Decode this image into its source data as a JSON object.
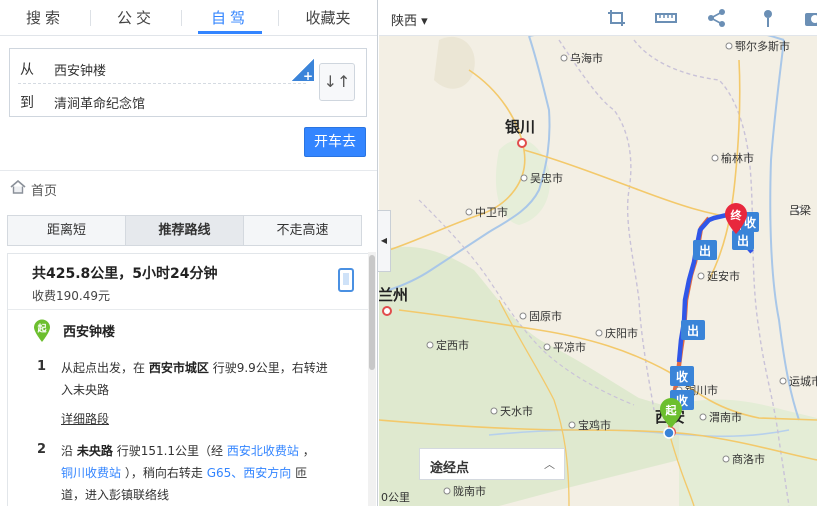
{
  "tabs": [
    {
      "label": "搜索"
    },
    {
      "label": "公交"
    },
    {
      "label": "自驾"
    },
    {
      "label": "收藏夹"
    }
  ],
  "route": {
    "from_label": "从",
    "from_value": "西安钟楼",
    "to_label": "到",
    "to_value": "清涧革命纪念馆",
    "add_symbol": "+",
    "swap_symbol": "↓↑"
  },
  "go_button": "开车去",
  "breadcrumb": "首页",
  "strategies": [
    {
      "label": "距离短"
    },
    {
      "label": "推荐路线"
    },
    {
      "label": "不走高速"
    }
  ],
  "summary": {
    "title": "共425.8公里，5小时24分钟",
    "toll": "收费190.49元"
  },
  "start": {
    "pin": "起",
    "name": "西安钟楼"
  },
  "steps": [
    {
      "no": "1",
      "line1_a": "从起点出发，在",
      "line1_b": "西安市城区",
      "line1_c": "行驶9.9公里，右转进",
      "line2": "入未央路",
      "detail_link": "详细路段"
    },
    {
      "no": "2",
      "line1_a": "沿",
      "line1_b": "未央路",
      "line1_c": "行驶151.1公里（经",
      "line1_link": "西安北收费站",
      "line1_d": "，",
      "line2_link1": "铜川收费站",
      "line2_a": "），稍向右转走",
      "line2_link2": "G65、西安方向",
      "line2_b": "匝",
      "line3": "道，进入彭镇联络线"
    }
  ],
  "collapse_symbol": "◀",
  "map": {
    "region": "陕西",
    "cities": {
      "wuhai": "乌海市",
      "eerduosi": "鄂尔多斯市",
      "yinchuan": "银川",
      "yulin": "榆林市",
      "wuzhong": "吴忠市",
      "zhongwei": "中卫市",
      "lvliang": "吕梁",
      "yanan": "延安市",
      "lanzhou": "兰州",
      "guyuan": "固原市",
      "qingyang": "庆阳市",
      "dingxi": "定西市",
      "pingliang": "平凉市",
      "tongchuan": "铜川市",
      "yuncheng": "运城市",
      "tianshui": "天水市",
      "baoji": "宝鸡市",
      "weinan": "渭南市",
      "xian": "西安",
      "shangluo": "商洛市",
      "longnan": "陇南市"
    },
    "route_signs": {
      "exit": "出",
      "toll": "收",
      "end": "终",
      "start": "起"
    },
    "waypoints_label": "途经点",
    "waypoints_chevron": "︿",
    "scale": "0公里",
    "colors": {
      "route": "#3056e8",
      "route_start": "#e06a44",
      "sign": "#3a84d8",
      "end_pin": "#e8283d",
      "start_pin": "#6cbf2e"
    }
  }
}
